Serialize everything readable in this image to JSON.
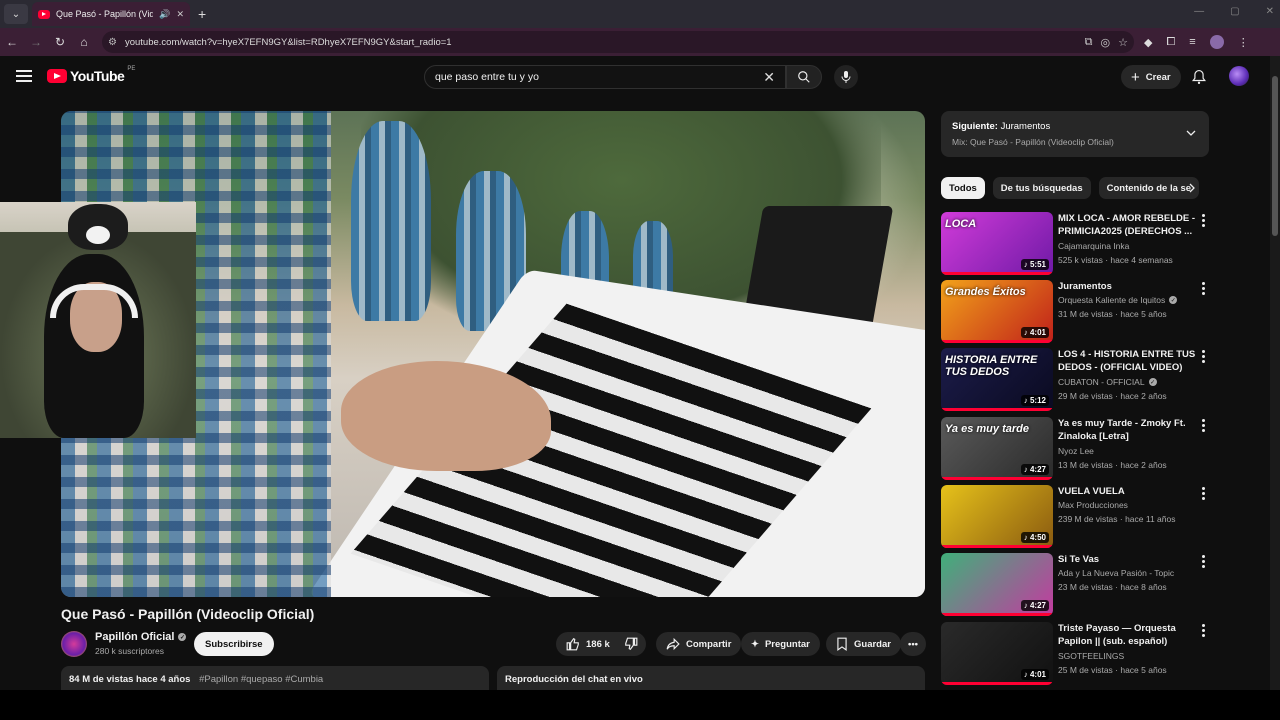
{
  "browser": {
    "tab_title": "Que Pasó - Papillón (Videoc",
    "url": "youtube.com/watch?v=hyeX7EFN9GY&list=RDhyeX7EFN9GY&start_radio=1"
  },
  "header": {
    "logo_text": "YouTube",
    "country": "PE",
    "search_query": "que paso entre tu y yo",
    "create_label": "Crear"
  },
  "video": {
    "title": "Que Pasó - Papillón (Videoclip Oficial)",
    "channel": "Papillón Oficial",
    "subscribers": "280 k suscriptores",
    "subscribe_label": "Subscribirse",
    "likes": "186 k",
    "share_label": "Compartir",
    "ask_label": "Preguntar",
    "save_label": "Guardar",
    "views_date": "84 M de vistas  hace 4 años",
    "tags": "#Papillon #quepaso #Cumbia",
    "live_chat_label": "Reproducción del chat en vivo"
  },
  "up_next": {
    "prefix": "Siguiente:",
    "title": "Juramentos",
    "mix": "Mix: Que Pasó - Papillón (Videoclip Oficial)"
  },
  "chips": [
    "Todos",
    "De tus búsquedas",
    "Contenido de la se"
  ],
  "recommendations": [
    {
      "title": "MIX LOCA - AMOR REBELDE - PRIMICIA2025 (DERECHOS ...",
      "channel": "Cajamarquina Inka",
      "verified": false,
      "meta": "525 k vistas · hace 4 semanas",
      "duration": "5:51",
      "overlay": "LOCA",
      "colors": [
        "#d13bd9",
        "#6f1aa6"
      ]
    },
    {
      "title": "Juramentos",
      "channel": "Orquesta Kaliente de Iquitos",
      "verified": true,
      "meta": "31 M de vistas · hace 5 años",
      "duration": "4:01",
      "overlay": "Grandes Éxitos",
      "colors": [
        "#f2a21a",
        "#c0201a"
      ]
    },
    {
      "title": "LOS 4 - HISTORIA ENTRE TUS DEDOS - (OFFICIAL VIDEO)",
      "channel": "CUBATON - OFFICIAL",
      "verified": true,
      "meta": "29 M de vistas · hace 2 años",
      "duration": "5:12",
      "overlay": "HISTORIA ENTRE TUS DEDOS",
      "colors": [
        "#1c1c4a",
        "#0a0a20"
      ]
    },
    {
      "title": "Ya es muy Tarde - Zmoky Ft. Zinaloka [Letra]",
      "channel": "Nyoz Lee",
      "verified": false,
      "meta": "13 M de vistas · hace 2 años",
      "duration": "4:27",
      "overlay": "Ya es muy tarde",
      "colors": [
        "#5a5a5a",
        "#2a2a2a"
      ]
    },
    {
      "title": "VUELA VUELA",
      "channel": "Max Producciones",
      "verified": false,
      "meta": "239 M de vistas · hace 11 años",
      "duration": "4:50",
      "overlay": "",
      "colors": [
        "#e6c21a",
        "#8a5a10"
      ]
    },
    {
      "title": "Si Te Vas",
      "channel": "Ada y La Nueva Pasión - Topic",
      "verified": false,
      "meta": "23 M de vistas · hace 8 años",
      "duration": "4:27",
      "overlay": "",
      "colors": [
        "#3fb07a",
        "#c43aa0"
      ]
    },
    {
      "title": "Triste Payaso — Orquesta Papilon || (sub. español)",
      "channel": "SGOTFEELINGS",
      "verified": false,
      "meta": "25 M de vistas · hace 5 años",
      "duration": "4:01",
      "overlay": "",
      "colors": [
        "#2a2a2a",
        "#111111"
      ]
    }
  ]
}
